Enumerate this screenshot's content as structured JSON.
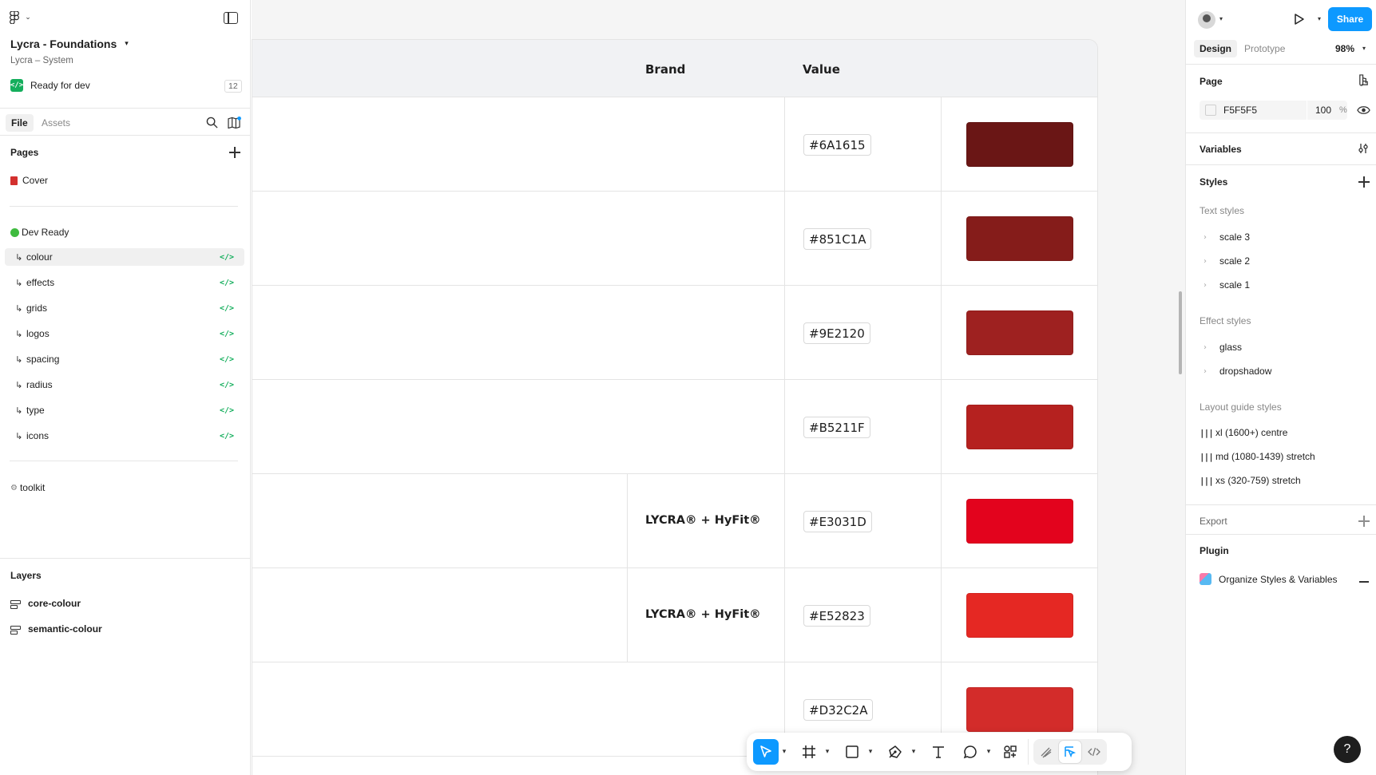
{
  "left_panel": {
    "file_title": "Lycra - Foundations",
    "file_subtitle": "Lycra – System",
    "dev_status": "Ready for dev",
    "dev_count": "12",
    "tabs": {
      "file": "File",
      "assets": "Assets"
    },
    "pages_title": "Pages",
    "cover_page": "Cover",
    "dev_ready_page": "Dev Ready",
    "sub_pages": [
      "colour",
      "effects",
      "grids",
      "logos",
      "spacing",
      "radius",
      "type",
      "icons"
    ],
    "toolkit_page": "toolkit",
    "layers_title": "Layers",
    "layers": [
      "core-colour",
      "semantic-colour"
    ]
  },
  "canvas": {
    "header": {
      "brand": "Brand",
      "value": "Value"
    },
    "rows": [
      {
        "brand": "",
        "hex": "#6A1615",
        "color": "#6A1615"
      },
      {
        "brand": "",
        "hex": "#851C1A",
        "color": "#851C1A"
      },
      {
        "brand": "",
        "hex": "#9E2120",
        "color": "#9E2120"
      },
      {
        "brand": "",
        "hex": "#B5211F",
        "color": "#B5211F"
      },
      {
        "brand": "LYCRA® + HyFit®",
        "hex": "#E3031D",
        "color": "#E3031D"
      },
      {
        "brand": "LYCRA® + HyFit®",
        "hex": "#E52823",
        "color": "#E52823"
      },
      {
        "brand": "",
        "hex": "#D32C2A",
        "color": "#D32C2A"
      }
    ]
  },
  "toolbar": {
    "tools": [
      "move-tool",
      "frame-tool",
      "shape-tool",
      "pen-tool",
      "text-tool",
      "comment-tool",
      "actions-tool"
    ],
    "modes": [
      "draw-mode",
      "design-mode",
      "dev-mode"
    ]
  },
  "right_panel": {
    "share": "Share",
    "modes": {
      "design": "Design",
      "prototype": "Prototype"
    },
    "zoom": "98%",
    "page_title": "Page",
    "page_bg_hex": "F5F5F5",
    "page_bg_opacity": "100",
    "page_bg_pct": "%",
    "variables_title": "Variables",
    "styles_title": "Styles",
    "text_styles_title": "Text styles",
    "text_styles": [
      "scale 3",
      "scale 2",
      "scale 1"
    ],
    "effect_styles_title": "Effect styles",
    "effect_styles": [
      "glass",
      "dropshadow"
    ],
    "layout_guide_title": "Layout guide styles",
    "layout_guides": [
      "xl (1600+) centre",
      "md (1080-1439) stretch",
      "xs (320-759) stretch"
    ],
    "export_title": "Export",
    "plugin_title": "Plugin",
    "plugin_name": "Organize Styles & Variables",
    "help": "?"
  }
}
